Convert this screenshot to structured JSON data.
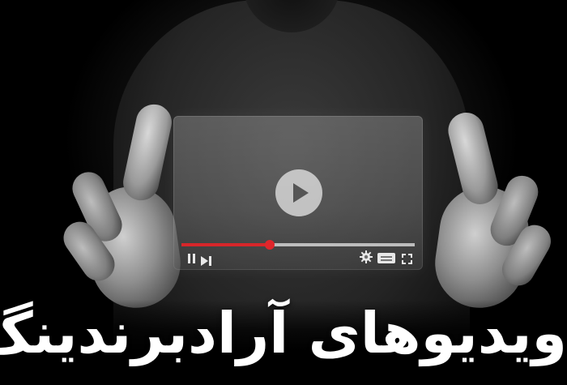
{
  "banner": {
    "title": "ویدیوهای آرادبرندینگ"
  },
  "player": {
    "progress_percent": 38,
    "play_icon": "play-icon",
    "controls": [
      "pause-icon",
      "next-icon",
      "gear-icon",
      "captions-icon",
      "fullscreen-icon"
    ]
  },
  "colors": {
    "background": "#000000",
    "progress": "#d7262a",
    "panel": "rgba(150,150,150,0.28)",
    "title": "#ffffff"
  }
}
